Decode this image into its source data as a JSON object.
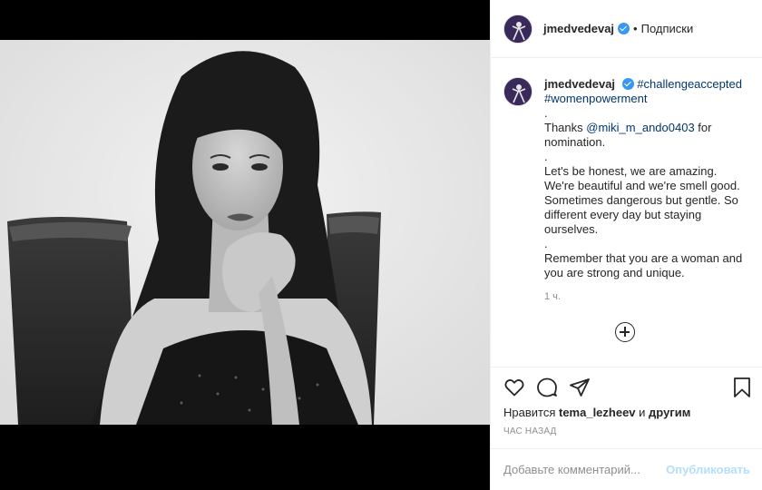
{
  "post": {
    "username": "jmedvedevaj",
    "follow_separator": "•",
    "follow_label": "Подписки",
    "image_alt": "Black and white portrait of a woman sitting in a carved wooden chair, chin resting on her hand"
  },
  "caption": {
    "username": "jmedvedevaj",
    "hashtag_1": "#challengeaccepted",
    "hashtag_2": "#womenpowerment",
    "dot_1": ".",
    "thanks_prefix": "Thanks ",
    "mention": "@miki_m_ando0403",
    "thanks_suffix": " for nomination.",
    "dot_2": ".",
    "para_1": "Let's be honest, we are amazing. We're beautiful and we're smell good. Sometimes dangerous but gentle. So different every day but staying ourselves.",
    "dot_3": ".",
    "para_2": "Remember that you are a woman and you are strong and unique.",
    "time": "1 ч."
  },
  "actions": {
    "like_icon": "heart-icon",
    "comment_icon": "comment-icon",
    "share_icon": "paper-plane-icon",
    "save_icon": "bookmark-icon",
    "liked_by_prefix": "Нравится ",
    "liked_by_user": "tema_lezheev",
    "liked_by_suffix": " и ",
    "liked_by_others": "другим",
    "time_ago": "час назад"
  },
  "comment": {
    "placeholder": "Добавьте комментарий...",
    "publish_label": "Опубликовать"
  },
  "colors": {
    "link": "#00376b",
    "verified": "#3897f0",
    "publish_disabled": "#b2dffc",
    "muted": "#8e8e8e"
  }
}
